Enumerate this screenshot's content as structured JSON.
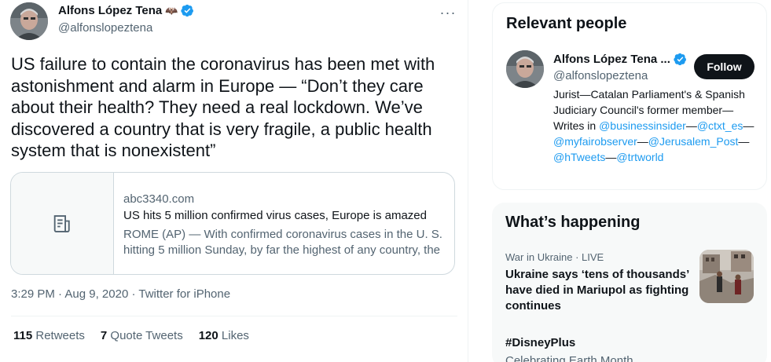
{
  "tweet": {
    "author_name": "Alfons López Tena",
    "author_emoji": "🦇",
    "author_handle": "@alfonslopeztena",
    "more_label": "···",
    "text": "US failure to contain the coronavirus has been met with astonishment and alarm in Europe — “Don’t they care about their health? They need a real lockdown. We’ve discovered a country that is very fragile, a public health system that is nonexistent”",
    "card": {
      "domain": "abc3340.com",
      "title": "US hits 5 million confirmed virus cases, Europe is amazed",
      "description": "ROME (AP) — With confirmed coronavirus cases in the U. S. hitting 5 million Sunday, by far the highest of any country, the"
    },
    "time": "3:29 PM",
    "date": "Aug 9, 2020",
    "separator": " · ",
    "source": "Twitter for iPhone",
    "stats": {
      "retweets_count": "115",
      "retweets_label": "Retweets",
      "quote_count": "7",
      "quote_label": "Quote Tweets",
      "likes_count": "120",
      "likes_label": "Likes"
    }
  },
  "relevant_people": {
    "title": "Relevant people",
    "name": "Alfons López Tena ...",
    "handle": "@alfonslopeztena",
    "follow_label": "Follow",
    "bio_text_1": "Jurist—Catalan Parliament's & Spanish Judiciary Council's former member—Writes in ",
    "mention_1": "@businessinsider",
    "dash_1": "—",
    "mention_2": "@ctxt_es",
    "dash_2": "—",
    "mention_3": "@myfairobserver",
    "dash_3": "—",
    "mention_4": "@Jerusalem_Post",
    "dash_4": "—",
    "mention_5": "@hTweets",
    "dash_5": "—",
    "mention_6": "@trtworld"
  },
  "whats_happening": {
    "title": "What’s happening",
    "trend1_category": "War in Ukraine",
    "trend1_dot": " · ",
    "trend1_live": "LIVE",
    "trend1_headline": "Ukraine says ‘tens of thousands’ have died in Mariupol as fighting continues",
    "trend2_title": "#DisneyPlus",
    "trend2_subtitle": "Celebrating Earth Month"
  },
  "colors": {
    "accent": "#1d9bf0",
    "text": "#0f1419",
    "secondary_text": "#536471",
    "border": "#cfd9de",
    "panel_bg": "#f7f9f9"
  },
  "icons": {
    "verified": "verified-badge-icon",
    "more": "more-icon",
    "card_placeholder": "article-icon"
  }
}
